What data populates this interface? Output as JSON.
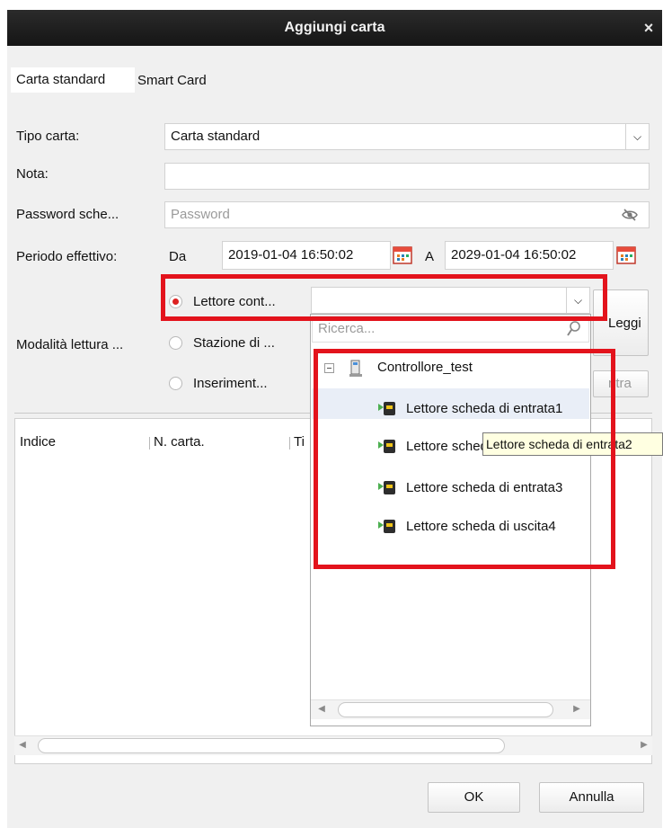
{
  "window": {
    "title": "Aggiungi carta",
    "close_label": "×"
  },
  "tabs": [
    {
      "label": "Carta standard"
    },
    {
      "label": "Smart Card"
    }
  ],
  "form": {
    "tipo_carta_label": "Tipo carta:",
    "tipo_carta_value": "Carta standard",
    "nota_label": "Nota:",
    "nota_value": "",
    "password_label": "Password sche...",
    "password_placeholder": "Password",
    "periodo_label": "Periodo effettivo:",
    "da_label": "Da",
    "da_value": "2019-01-04 16:50:02",
    "a_label": "A",
    "a_value": "2029-01-04 16:50:02",
    "modalita_label": "Modalità lettura ...",
    "radio_options": [
      {
        "label": "Lettore cont...",
        "selected": true
      },
      {
        "label": "Stazione di ...",
        "selected": false
      },
      {
        "label": "Inseriment...",
        "selected": false
      }
    ],
    "reader_select_value": "",
    "leggi_button": "Leggi",
    "entra_button": "ntra"
  },
  "dropdown": {
    "search_placeholder": "Ricerca...",
    "tree": {
      "root": "Controllore_test",
      "items": [
        "Lettore scheda di entrata1",
        "Lettore scheda di entrata2",
        "Lettore scheda di entrata3",
        "Lettore scheda di uscita4"
      ]
    },
    "tooltip": "Lettore scheda di entrata2"
  },
  "table": {
    "columns": [
      "Indice",
      "N. carta.",
      "Ti"
    ]
  },
  "footer": {
    "ok_label": "OK",
    "cancel_label": "Annulla"
  },
  "colors": {
    "highlight_red": "#e3131c",
    "titlebar": "#1c1c1c",
    "dialog_bg": "#f0f0f0"
  }
}
